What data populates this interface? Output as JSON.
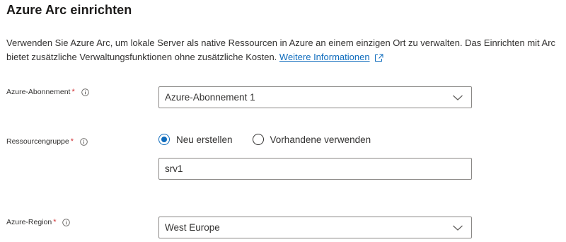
{
  "page": {
    "title": "Azure Arc einrichten",
    "description": "Verwenden Sie Azure Arc, um lokale Server als native Ressourcen in Azure an einem einzigen Ort zu verwalten. Das Einrichten mit Arc bietet zusätzliche Verwaltungsfunktionen ohne zusätzliche Kosten.",
    "learn_more_link": "Weitere Informationen"
  },
  "fields": {
    "subscription": {
      "label": "Azure-Abonnement",
      "required_marker": "*",
      "value": "Azure-Abonnement 1"
    },
    "resource_group": {
      "label": "Ressourcengruppe",
      "required_marker": "*",
      "option_new": "Neu erstellen",
      "option_existing": "Vorhandene verwenden",
      "selected_option": "Neu erstellen",
      "value": "srv1"
    },
    "region": {
      "label": "Azure-Region",
      "required_marker": "*",
      "value": "West Europe"
    }
  },
  "colors": {
    "accent": "#0f6cbd",
    "required": "#d13438",
    "text": "#323130",
    "border": "#8a8886"
  },
  "icons": {
    "info": "info-circle-icon",
    "external_link": "external-link-icon",
    "dropdown": "chevron-down-icon"
  }
}
